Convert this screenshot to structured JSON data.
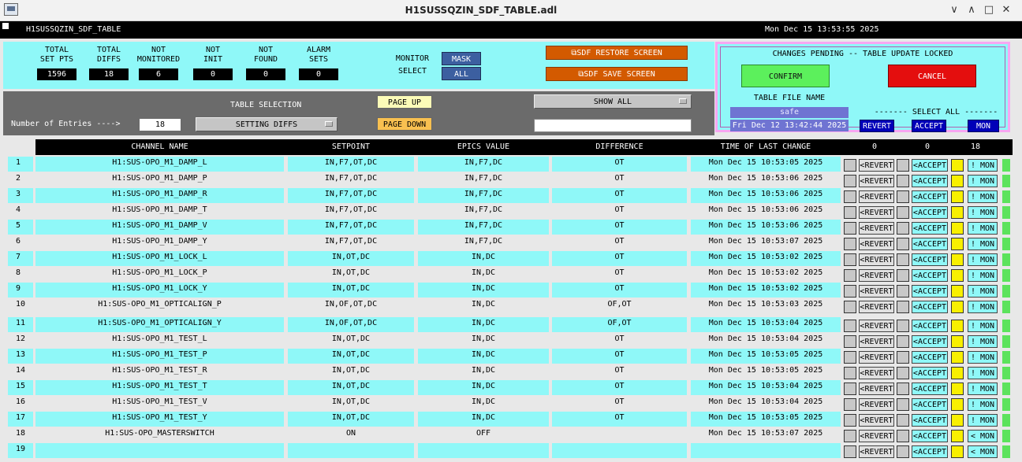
{
  "window": {
    "title": "H1SUSSQZIN_SDF_TABLE.adl",
    "min": "∨",
    "max": "∧",
    "restore": "□",
    "close": "✕"
  },
  "header": {
    "name": "H1SUSSQZIN_SDF_TABLE",
    "datetime": "Mon Dec 15 13:53:55 2025"
  },
  "stats": [
    {
      "label": "TOTAL\nSET PTS",
      "value": "1596"
    },
    {
      "label": "TOTAL\nDIFFS",
      "value": "18"
    },
    {
      "label": "NOT\nMONITORED",
      "value": "6"
    },
    {
      "label": "NOT\nINIT",
      "value": "0"
    },
    {
      "label": "NOT\nFOUND",
      "value": "0"
    },
    {
      "label": "ALARM\nSETS",
      "value": "0"
    }
  ],
  "monitor": {
    "label": "MONITOR\nSELECT",
    "mask": "MASK",
    "all": "ALL"
  },
  "buttons": {
    "restore": "⧉SDF RESTORE SCREEN",
    "save": "⧉SDF SAVE SCREEN"
  },
  "pending": {
    "heading": "CHANGES PENDING -- TABLE UPDATE LOCKED",
    "confirm": "CONFIRM",
    "cancel": "CANCEL",
    "table_file_label": "TABLE FILE NAME",
    "table_file_value": "safe",
    "table_file_date": "Fri Dec 12 13:42:44 2025",
    "select_all_label": "------- SELECT ALL -------",
    "revert": "REVERT",
    "accept": "ACCEPT",
    "mon": "MON"
  },
  "controls": {
    "table_selection_label": "TABLE SELECTION",
    "entries_label": "Number of Entries ---->",
    "entries_value": "18",
    "table_selection_value": "SETTING DIFFS",
    "page_up": "PAGE UP",
    "page_down": "PAGE DOWN",
    "show_all": "SHOW ALL"
  },
  "table": {
    "headers": {
      "channel": "CHANNEL NAME",
      "setpoint": "SETPOINT",
      "epics": "EPICS VALUE",
      "difference": "DIFFERENCE",
      "time": "TIME OF LAST CHANGE",
      "count_revert": "0",
      "count_accept": "0",
      "count_mon": "18"
    },
    "revert_label": "<REVERT",
    "accept_label": "<ACCEPT",
    "mon_label": "! MON",
    "mon_label_alt": "< MON",
    "rows": [
      {
        "num": "1",
        "name": "H1:SUS-OPO_M1_DAMP_L",
        "setpoint": "IN,F7,OT,DC",
        "epics": "IN,F7,DC",
        "diff": "OT",
        "time": "Mon Dec 15 10:53:05 2025"
      },
      {
        "num": "2",
        "name": "H1:SUS-OPO_M1_DAMP_P",
        "setpoint": "IN,F7,OT,DC",
        "epics": "IN,F7,DC",
        "diff": "OT",
        "time": "Mon Dec 15 10:53:06 2025"
      },
      {
        "num": "3",
        "name": "H1:SUS-OPO_M1_DAMP_R",
        "setpoint": "IN,F7,OT,DC",
        "epics": "IN,F7,DC",
        "diff": "OT",
        "time": "Mon Dec 15 10:53:06 2025"
      },
      {
        "num": "4",
        "name": "H1:SUS-OPO_M1_DAMP_T",
        "setpoint": "IN,F7,OT,DC",
        "epics": "IN,F7,DC",
        "diff": "OT",
        "time": "Mon Dec 15 10:53:06 2025"
      },
      {
        "num": "5",
        "name": "H1:SUS-OPO_M1_DAMP_V",
        "setpoint": "IN,F7,OT,DC",
        "epics": "IN,F7,DC",
        "diff": "OT",
        "time": "Mon Dec 15 10:53:06 2025"
      },
      {
        "num": "6",
        "name": "H1:SUS-OPO_M1_DAMP_Y",
        "setpoint": "IN,F7,OT,DC",
        "epics": "IN,F7,DC",
        "diff": "OT",
        "time": "Mon Dec 15 10:53:07 2025"
      },
      {
        "num": "7",
        "name": "H1:SUS-OPO_M1_LOCK_L",
        "setpoint": "IN,OT,DC",
        "epics": "IN,DC",
        "diff": "OT",
        "time": "Mon Dec 15 10:53:02 2025"
      },
      {
        "num": "8",
        "name": "H1:SUS-OPO_M1_LOCK_P",
        "setpoint": "IN,OT,DC",
        "epics": "IN,DC",
        "diff": "OT",
        "time": "Mon Dec 15 10:53:02 2025"
      },
      {
        "num": "9",
        "name": "H1:SUS-OPO_M1_LOCK_Y",
        "setpoint": "IN,OT,DC",
        "epics": "IN,DC",
        "diff": "OT",
        "time": "Mon Dec 15 10:53:02 2025"
      },
      {
        "num": "10",
        "name": "H1:SUS-OPO_M1_OPTICALIGN_P",
        "setpoint": "IN,OF,OT,DC",
        "epics": "IN,DC",
        "diff": "OF,OT",
        "time": "Mon Dec 15 10:53:03 2025"
      },
      {
        "num": "11",
        "name": "H1:SUS-OPO_M1_OPTICALIGN_Y",
        "setpoint": "IN,OF,OT,DC",
        "epics": "IN,DC",
        "diff": "OF,OT",
        "time": "Mon Dec 15 10:53:04 2025"
      },
      {
        "num": "12",
        "name": "H1:SUS-OPO_M1_TEST_L",
        "setpoint": "IN,OT,DC",
        "epics": "IN,DC",
        "diff": "OT",
        "time": "Mon Dec 15 10:53:04 2025"
      },
      {
        "num": "13",
        "name": "H1:SUS-OPO_M1_TEST_P",
        "setpoint": "IN,OT,DC",
        "epics": "IN,DC",
        "diff": "OT",
        "time": "Mon Dec 15 10:53:05 2025"
      },
      {
        "num": "14",
        "name": "H1:SUS-OPO_M1_TEST_R",
        "setpoint": "IN,OT,DC",
        "epics": "IN,DC",
        "diff": "OT",
        "time": "Mon Dec 15 10:53:05 2025"
      },
      {
        "num": "15",
        "name": "H1:SUS-OPO_M1_TEST_T",
        "setpoint": "IN,OT,DC",
        "epics": "IN,DC",
        "diff": "OT",
        "time": "Mon Dec 15 10:53:04 2025"
      },
      {
        "num": "16",
        "name": "H1:SUS-OPO_M1_TEST_V",
        "setpoint": "IN,OT,DC",
        "epics": "IN,DC",
        "diff": "OT",
        "time": "Mon Dec 15 10:53:04 2025"
      },
      {
        "num": "17",
        "name": "H1:SUS-OPO_M1_TEST_Y",
        "setpoint": "IN,OT,DC",
        "epics": "IN,DC",
        "diff": "OT",
        "time": "Mon Dec 15 10:53:05 2025"
      },
      {
        "num": "18",
        "name": "H1:SUS-OPO_MASTERSWITCH",
        "setpoint": "ON",
        "epics": "OFF",
        "diff": "",
        "time": "Mon Dec 15 10:53:07 2025"
      },
      {
        "num": "19",
        "name": "",
        "setpoint": "",
        "epics": "",
        "diff": "",
        "time": ""
      }
    ]
  }
}
